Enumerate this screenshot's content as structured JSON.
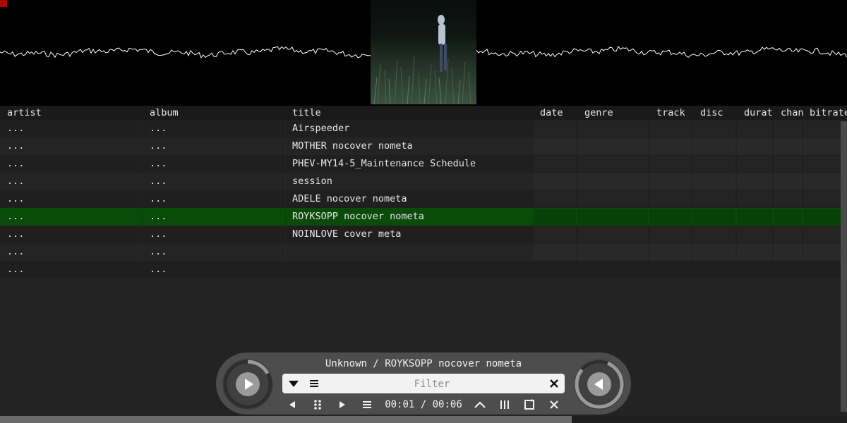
{
  "columns": [
    "artist",
    "album",
    "title",
    "date",
    "genre",
    "track",
    "disc",
    "durat",
    "chan",
    "bitrate"
  ],
  "rows": [
    {
      "artist": "...",
      "album": "...",
      "title": "Airspeeder"
    },
    {
      "artist": "...",
      "album": "...",
      "title": "MOTHER nocover nometa"
    },
    {
      "artist": "...",
      "album": "...",
      "title": "PHEV-MY14-5_Maintenance Schedule"
    },
    {
      "artist": "...",
      "album": "...",
      "title": "session"
    },
    {
      "artist": "...",
      "album": "...",
      "title": "ADELE nocover nometa"
    },
    {
      "artist": "...",
      "album": "...",
      "title": "ROYKSOPP nocover nometa",
      "selected": true
    },
    {
      "artist": "...",
      "album": "...",
      "title": "NOINLOVE cover meta"
    },
    {
      "artist": "...",
      "album": "...",
      "title": ""
    },
    {
      "artist": "...",
      "album": "...",
      "title": ""
    }
  ],
  "player": {
    "now_playing": "Unknown / ROYKSOPP nocover nometa",
    "time": "00:01 / 00:06",
    "progress_fraction": 0.17,
    "filter_placeholder": "Filter"
  },
  "icons": {
    "play": "play-icon",
    "back": "previous-icon",
    "filter_dropdown": "dropdown-icon",
    "menu": "menu-icon",
    "clear": "close-icon"
  },
  "colors": {
    "selected_row": "#0a4b0a",
    "selected_highlight": "#6a8f6a",
    "waveform": "#ffffff",
    "accent_mark": "#b00000"
  }
}
